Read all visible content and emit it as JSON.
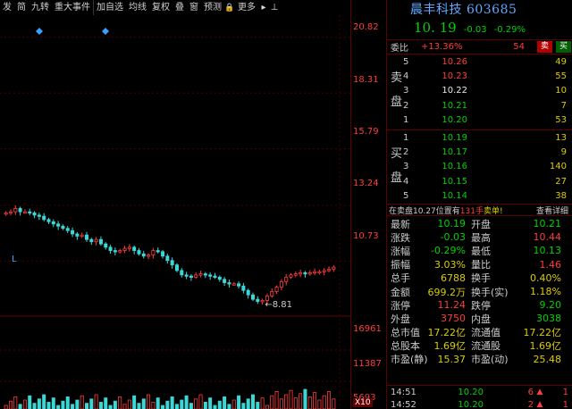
{
  "toolbar": {
    "items": [
      "发",
      "简",
      "九转",
      "重大事件",
      "加自选",
      "均线",
      "复权",
      "叠",
      "窗",
      "预测",
      "更多"
    ]
  },
  "stock": {
    "name": "晨丰科技",
    "code": "603685",
    "price": "10. 19",
    "change": "-0.03",
    "change_pct": "-0.29%"
  },
  "weibi": {
    "label": "委比",
    "ratio": "+13.36%",
    "diff": "54",
    "buy_label": "买",
    "sell_label": "卖"
  },
  "order_book": {
    "sell_label_1": "卖",
    "sell_label_2": "盘",
    "buy_label_1": "买",
    "buy_label_2": "盘",
    "sell": [
      {
        "n": "5",
        "price": "10.26",
        "vol": "49",
        "color": "red"
      },
      {
        "n": "4",
        "price": "10.23",
        "vol": "55",
        "color": "red"
      },
      {
        "n": "3",
        "price": "10.22",
        "vol": "10",
        "color": "white"
      },
      {
        "n": "2",
        "price": "10.21",
        "vol": "7",
        "color": "green"
      },
      {
        "n": "1",
        "price": "10.20",
        "vol": "53",
        "color": "green"
      }
    ],
    "buy": [
      {
        "n": "1",
        "price": "10.19",
        "vol": "13",
        "color": "green"
      },
      {
        "n": "2",
        "price": "10.17",
        "vol": "9",
        "color": "green"
      },
      {
        "n": "3",
        "price": "10.16",
        "vol": "140",
        "color": "green"
      },
      {
        "n": "4",
        "price": "10.15",
        "vol": "27",
        "color": "green"
      },
      {
        "n": "5",
        "price": "10.14",
        "vol": "38",
        "color": "green"
      }
    ]
  },
  "status_bar": {
    "text_prefix": "在卖盘10.27位置有",
    "text_qty": "131手",
    "text_suffix": "卖单!",
    "link": "查看详细"
  },
  "quote": [
    {
      "k1": "最新",
      "v1": "10.19",
      "c1": "green",
      "k2": "开盘",
      "v2": "10.21",
      "c2": "green"
    },
    {
      "k1": "涨跌",
      "v1": "-0.03",
      "c1": "green",
      "k2": "最高",
      "v2": "10.44",
      "c2": "red"
    },
    {
      "k1": "涨幅",
      "v1": "-0.29%",
      "c1": "green",
      "k2": "最低",
      "v2": "10.13",
      "c2": "green"
    },
    {
      "k1": "振幅",
      "v1": "3.03%",
      "c1": "yellow",
      "k2": "量比",
      "v2": "1.46",
      "c2": "red"
    },
    {
      "k1": "总手",
      "v1": "6788",
      "c1": "yellow",
      "k2": "换手",
      "v2": "0.40%",
      "c2": "yellow"
    },
    {
      "k1": "金额",
      "v1": "699.2万",
      "c1": "yellow",
      "k2": "换手(实)",
      "v2": "1.18%",
      "c2": "yellow"
    },
    {
      "k1": "涨停",
      "v1": "11.24",
      "c1": "red",
      "k2": "跌停",
      "v2": "9.20",
      "c2": "green"
    },
    {
      "k1": "外盘",
      "v1": "3750",
      "c1": "red",
      "k2": "内盘",
      "v2": "3038",
      "c2": "green"
    },
    {
      "k1": "总市值",
      "v1": "17.22亿",
      "c1": "yellow",
      "k2": "流通值",
      "v2": "17.22亿",
      "c2": "yellow"
    },
    {
      "k1": "总股本",
      "v1": "1.69亿",
      "c1": "yellow",
      "k2": "流通股",
      "v2": "1.69亿",
      "c2": "yellow"
    },
    {
      "k1": "市盈(静)",
      "v1": "15.37",
      "c1": "yellow",
      "k2": "市盈(动)",
      "v2": "25.48",
      "c2": "yellow"
    }
  ],
  "trades": [
    {
      "t": "14:51",
      "p": "10.20",
      "q": "6",
      "c": "1"
    },
    {
      "t": "14:52",
      "p": "10.20",
      "q": "2",
      "c": "1"
    },
    {
      "t": "14:52",
      "p": "10.20",
      "q": "1",
      "c": "1"
    }
  ],
  "chart_data": {
    "type": "candlestick",
    "y_ticks": [
      "20.82",
      "18.31",
      "15.79",
      "13.24",
      "10.73"
    ],
    "vol_ticks": [
      "16961",
      "11387",
      "5693"
    ],
    "vol_unit": "X10",
    "low_marker": "8.81",
    "marker_L": "L",
    "ylim": [
      8.2,
      21.5
    ],
    "closes": [
      12.9,
      12.95,
      13.1,
      12.95,
      12.95,
      12.9,
      12.8,
      12.75,
      12.6,
      12.5,
      12.4,
      12.3,
      12.2,
      12.1,
      11.95,
      11.85,
      11.9,
      11.7,
      11.6,
      11.7,
      11.5,
      11.35,
      11.2,
      11.15,
      11.2,
      11.3,
      11.35,
      11.2,
      11.05,
      10.95,
      11.0,
      11.2,
      11.15,
      10.95,
      10.75,
      10.55,
      10.3,
      10.1,
      10.05,
      10.0,
      10.1,
      10.15,
      10.1,
      10.05,
      10.0,
      9.9,
      9.75,
      9.7,
      9.7,
      9.6,
      9.4,
      9.2,
      9.0,
      8.9,
      8.95,
      9.15,
      9.35,
      9.55,
      9.8,
      10.0,
      10.1,
      10.15,
      10.2,
      10.15,
      10.2,
      10.25,
      10.25,
      10.3,
      10.35,
      10.45
    ]
  }
}
